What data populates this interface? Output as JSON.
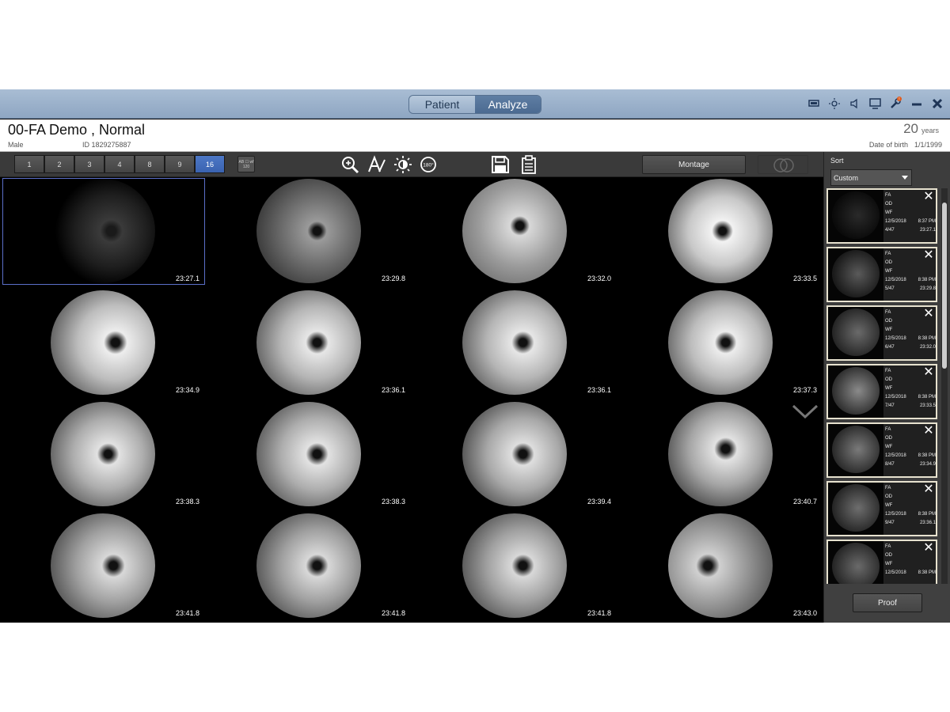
{
  "titlebar": {
    "modes": [
      "Patient",
      "Analyze"
    ],
    "active_mode": "Analyze",
    "icons": [
      "display-icon",
      "brightness-icon",
      "volume-icon",
      "monitor-icon",
      "tools-warning-icon",
      "minimize-icon",
      "close-icon"
    ]
  },
  "patient": {
    "name": "00-FA Demo , Normal",
    "sex": "Male",
    "id": "ID 1829275887",
    "age_value": "20",
    "age_unit": "years",
    "dob_label": "Date of birth",
    "dob": "1/1/1999"
  },
  "toolbar": {
    "layout_options": [
      "1",
      "2",
      "3",
      "4",
      "8",
      "9",
      "16"
    ],
    "active_layout": "16",
    "small_tool_label": "AB ☐ wf 120",
    "tools": [
      "zoom-icon",
      "annotate-icon",
      "brightness-contrast-icon",
      "rotate-180-icon",
      "save-icon",
      "clipboard-icon"
    ],
    "rotate_text": "180°",
    "montage_label": "Montage"
  },
  "images": [
    {
      "time": "23:27.1"
    },
    {
      "time": "23:29.8"
    },
    {
      "time": "23:32.0"
    },
    {
      "time": "23:33.5"
    },
    {
      "time": "23:34.9"
    },
    {
      "time": "23:36.1"
    },
    {
      "time": "23:36.1"
    },
    {
      "time": "23:37.3"
    },
    {
      "time": "23:38.3"
    },
    {
      "time": "23:38.3"
    },
    {
      "time": "23:39.4"
    },
    {
      "time": "23:40.7"
    },
    {
      "time": "23:41.8"
    },
    {
      "time": "23:41.8"
    },
    {
      "time": "23:41.8"
    },
    {
      "time": "23:43.0"
    }
  ],
  "sidebar": {
    "sort_label": "Sort",
    "sort_value": "Custom",
    "thumbs": [
      {
        "mode": "FA",
        "eye": "OD",
        "field": "WF",
        "date": "12/5/2018",
        "clock": "8:37 PM",
        "index": "4/47",
        "time": "23:27.1"
      },
      {
        "mode": "FA",
        "eye": "OD",
        "field": "WF",
        "date": "12/5/2018",
        "clock": "8:38 PM",
        "index": "5/47",
        "time": "23:29.8"
      },
      {
        "mode": "FA",
        "eye": "OD",
        "field": "WF",
        "date": "12/5/2018",
        "clock": "8:38 PM",
        "index": "6/47",
        "time": "23:32.0"
      },
      {
        "mode": "FA",
        "eye": "OD",
        "field": "WF",
        "date": "12/5/2018",
        "clock": "8:38 PM",
        "index": "7/47",
        "time": "23:33.5"
      },
      {
        "mode": "FA",
        "eye": "OD",
        "field": "WF",
        "date": "12/5/2018",
        "clock": "8:38 PM",
        "index": "8/47",
        "time": "23:34.9"
      },
      {
        "mode": "FA",
        "eye": "OD",
        "field": "WF",
        "date": "12/5/2018",
        "clock": "8:38 PM",
        "index": "9/47",
        "time": "23:36.1"
      },
      {
        "mode": "FA",
        "eye": "OD",
        "field": "WF",
        "date": "12/5/2018",
        "clock": "8:38 PM",
        "index": "",
        "time": ""
      }
    ],
    "proof_label": "Proof"
  }
}
